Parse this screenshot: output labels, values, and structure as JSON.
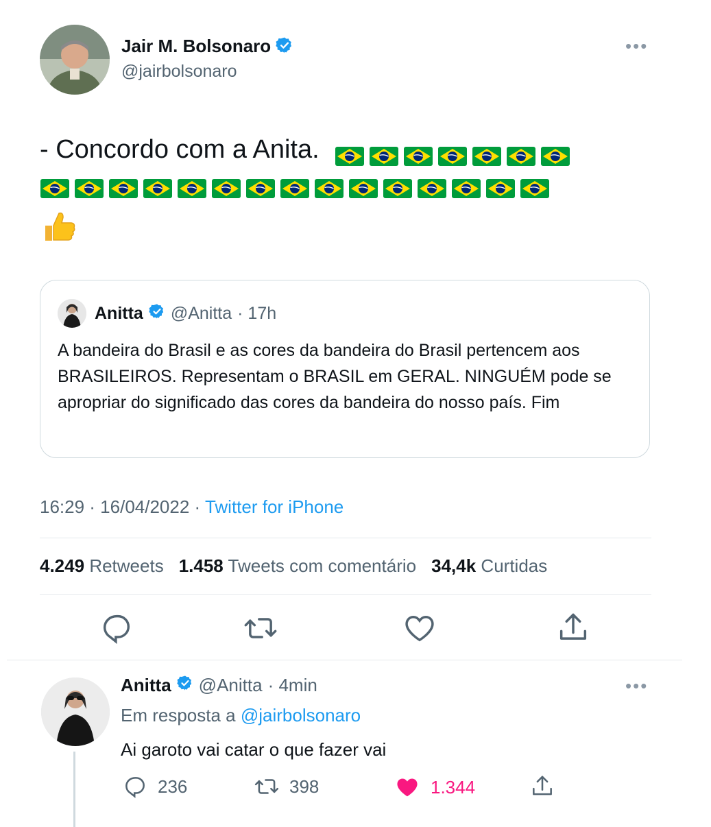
{
  "main_tweet": {
    "author_name": "Jair M. Bolsonaro",
    "author_handle": "@jairbolsonaro",
    "text": "- Concordo com a Anita.",
    "flag_emoji_count_line1": 7,
    "flag_emoji_count_line2": 15,
    "timestamp": "16:29 · 16/04/2022 · ",
    "source": "Twitter for iPhone",
    "stats": {
      "retweets_value": "4.249",
      "retweets_label": "Retweets",
      "quotes_value": "1.458",
      "quotes_label": "Tweets com comentário",
      "likes_value": "34,4k",
      "likes_label": "Curtidas"
    }
  },
  "quoted_tweet": {
    "author_name": "Anitta",
    "author_handle": "@Anitta",
    "time": "· 17h",
    "text": "A bandeira do Brasil e as cores da bandeira do Brasil pertencem aos BRASILEIROS. Representam o BRASIL em GERAL. NINGUÉM pode se apropriar do significado das cores da bandeira do nosso país. Fim"
  },
  "reply": {
    "author_name": "Anitta",
    "author_handle": "@Anitta",
    "time": "· 4min",
    "reply_to_prefix": "Em resposta a ",
    "reply_to_handle": "@jairbolsonaro",
    "text": "Ai garoto vai catar o que fazer vai",
    "reply_count": "236",
    "retweet_count": "398",
    "like_count": "1.344"
  },
  "colors": {
    "accent": "#1d9bf0",
    "like": "#f91880",
    "muted": "#536471",
    "flag_green": "#009c3b",
    "flag_yellow": "#ffdf00",
    "flag_blue": "#002776"
  }
}
